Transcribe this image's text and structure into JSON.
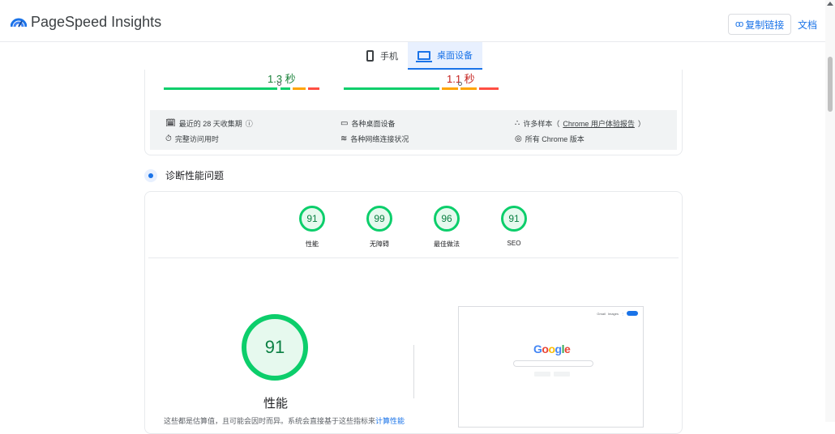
{
  "header": {
    "brand": "PageSpeed Insights",
    "copy_link": "复制链接",
    "docs": "文档"
  },
  "device_tabs": [
    {
      "label": "手机",
      "active": false
    },
    {
      "label": "桌面设备",
      "active": true
    }
  ],
  "metrics": [
    {
      "value": "1.3 秒",
      "color": "#188038",
      "marker_fraction": 0.75
    },
    {
      "value": "1.1 秒",
      "color": "#c5221f",
      "marker_fraction": 0.78
    }
  ],
  "info": {
    "collection_period": "最近的 28 天收集期",
    "visit_duration": "完整访问用时",
    "devices": "各种桌面设备",
    "network": "各种网络连接状况",
    "samples_prefix": "许多样本（",
    "samples_link": "Chrome 用户体验报告",
    "samples_suffix": "）",
    "chrome_versions": "所有 Chrome 版本"
  },
  "diagnose": {
    "title": "诊断性能问题"
  },
  "scores": [
    {
      "value": "91",
      "label": "性能"
    },
    {
      "value": "99",
      "label": "无障碍"
    },
    {
      "value": "96",
      "label": "最佳做法"
    },
    {
      "value": "91",
      "label": "SEO"
    }
  ],
  "performance": {
    "score": "91",
    "label": "性能",
    "desc_text": "这些都是估算值，且可能会因时而异。系统会直接基于这些指标来",
    "desc_link": "计算性能"
  },
  "screenshot": {
    "logo": "Google",
    "links": [
      "Gmail",
      "Images"
    ]
  },
  "colors": {
    "pass": "#0cce6b",
    "average": "#ffa400",
    "fail": "#ff4e42",
    "link": "#1a73e8"
  }
}
